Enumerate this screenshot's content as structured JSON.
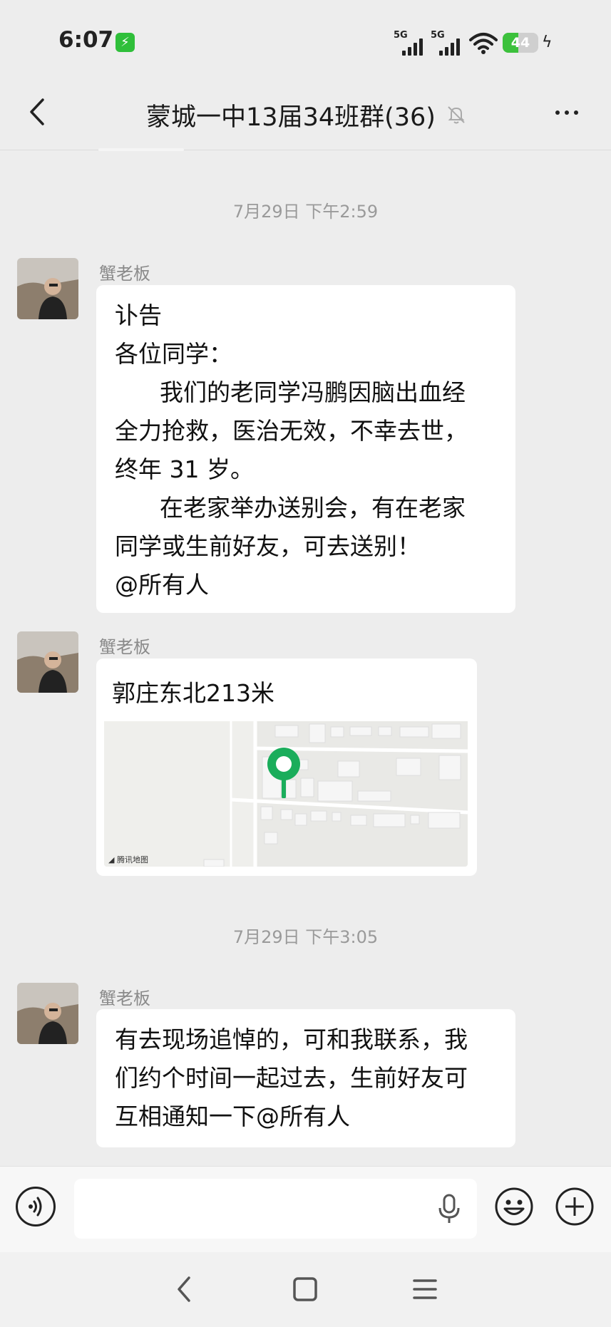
{
  "status_bar": {
    "time": "6:07",
    "signal1_label": "5G",
    "signal2_label": "5G",
    "battery_level": "44",
    "battery_fraction": 0.44
  },
  "header": {
    "title": "蒙城一中13届34班群(36)",
    "back_icon": "chevron-left-icon",
    "mute_icon": "bell-muted-icon",
    "more_icon": "more-dots-icon"
  },
  "messages": [
    {
      "timestamp": "7月29日 下午2:59",
      "sender": "蟹老板",
      "type": "text",
      "lines": [
        "讣告",
        "各位同学：",
        "      我们的老同学冯鹏因脑出血经",
        "全力抢救，医治无效，不幸去世，",
        "终年 31 岁。",
        "      在老家举办送别会，有在老家",
        "同学或生前好友，可去送别！",
        "@所有人"
      ]
    },
    {
      "sender": "蟹老板",
      "type": "location",
      "location_title": "郭庄东北213米",
      "map_credit": "腾讯地图"
    },
    {
      "timestamp": "7月29日 下午3:05",
      "sender": "蟹老板",
      "type": "text",
      "lines": [
        "有去现场追悼的，可和我联系，我",
        "们约个时间一起过去，生前好友可",
        "互相通知一下@所有人"
      ]
    }
  ],
  "input_bar": {
    "voice_icon": "voice-icon",
    "mic_icon": "microphone-icon",
    "emoji_icon": "emoji-icon",
    "plus_icon": "plus-icon"
  },
  "system_nav": {
    "back_icon": "nav-back-icon",
    "home_icon": "nav-home-icon",
    "menu_icon": "nav-menu-icon"
  },
  "colors": {
    "background": "#ededed",
    "bubble": "#ffffff",
    "map_pin": "#1aad5b",
    "battery": "#3cc13c"
  }
}
